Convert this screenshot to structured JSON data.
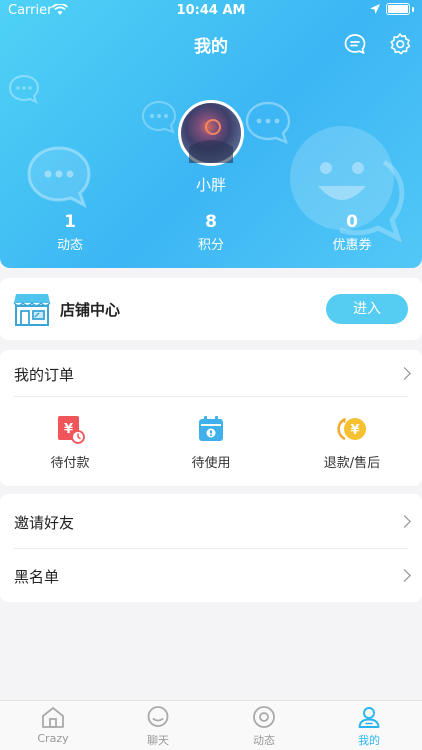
{
  "status_bar": {
    "carrier": "Carrier",
    "time": "10:44 AM"
  },
  "nav": {
    "title": "我的",
    "icons": [
      "message-icon",
      "settings-icon"
    ]
  },
  "profile": {
    "username": "小胖",
    "stats": [
      {
        "value": "1",
        "label": "动态"
      },
      {
        "value": "8",
        "label": "积分"
      },
      {
        "value": "0",
        "label": "优惠券"
      }
    ]
  },
  "shop": {
    "title": "店铺中心",
    "button": "进入",
    "icon": "storefront-icon"
  },
  "orders": {
    "title": "我的订单",
    "items": [
      {
        "label": "待付款",
        "icon": "pending-payment-icon"
      },
      {
        "label": "待使用",
        "icon": "calendar-icon"
      },
      {
        "label": "退款/售后",
        "icon": "refund-icon"
      }
    ]
  },
  "links": [
    {
      "label": "邀请好友"
    },
    {
      "label": "黑名单"
    }
  ],
  "tabbar": {
    "tabs": [
      {
        "label": "Crazy",
        "icon": "home-icon"
      },
      {
        "label": "聊天",
        "icon": "chat-icon"
      },
      {
        "label": "动态",
        "icon": "moments-icon"
      },
      {
        "label": "我的",
        "icon": "profile-icon",
        "active": true
      }
    ]
  },
  "colors": {
    "accent": "#29b6ee",
    "header_start": "#4fd2f5",
    "header_end": "#3cb6f4",
    "button": "#55ccf2"
  }
}
